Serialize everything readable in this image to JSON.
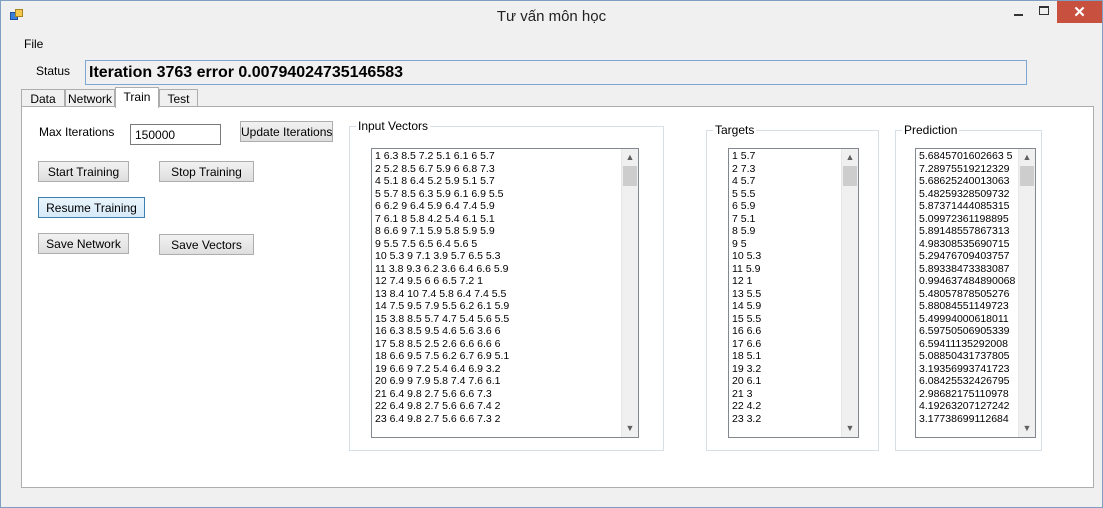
{
  "window": {
    "title": "Tư vấn môn học",
    "close_glyph": "✕",
    "icons": [
      "app-icon",
      "minimize-icon",
      "maximize-icon",
      "close-icon"
    ]
  },
  "menu": {
    "file": "File"
  },
  "status": {
    "label": "Status",
    "text": "Iteration 3763 error 0.00794024735146583"
  },
  "tabs": [
    {
      "label": "Data"
    },
    {
      "label": "Network"
    },
    {
      "label": "Train"
    },
    {
      "label": "Test"
    }
  ],
  "active_tab": "Train",
  "train": {
    "max_iterations_label": "Max Iterations",
    "max_iterations_value": "150000",
    "update_button": "Update Iterations",
    "start_button": "Start Training",
    "stop_button": "Stop Training",
    "resume_button": "Resume Training",
    "save_network_button": "Save Network",
    "save_vectors_button": "Save Vectors"
  },
  "input_vectors": {
    "title": "Input Vectors",
    "items": [
      "1 6.3 8.5 7.2 5.1 6.1 6 5.7",
      "2 5.2 8.5 6.7 5.9 6 6.8 7.3",
      "4 5.1 8 6.4 5.2 5.9 5.1 5.7",
      "5 5.7 8.5 6.3 5.9 6.1 6.9 5.5",
      "6 6.2 9 6.4 5.9 6.4 7.4 5.9",
      "7 6.1 8 5.8 4.2 5.4 6.1 5.1",
      "8 6.6 9 7.1 5.9 5.8 5.9 5.9",
      "9 5.5 7.5 6.5 6.4 5.6 5",
      "10 5.3 9 7.1 3.9 5.7 6.5 5.3",
      "11 3.8 9.3 6.2 3.6 6.4 6.6 5.9",
      "12 7.4 9.5 6 6 6.5 7.2 1",
      "13 8.4 10 7.4 5.8 6.4 7.4 5.5",
      "14 7.5 9.5 7.9 5.5 6.2 6.1 5.9",
      "15 3.8 8.5 5.7 4.7 5.4 5.6 5.5",
      "16 6.3 8.5 9.5 4.6 5.6 3.6 6",
      "17 5.8 8.5 2.5 2.6 6.6 6.6 6",
      "18 6.6 9.5 7.5 6.2 6.7 6.9 5.1",
      "19 6.6 9 7.2 5.4 6.4 6.9 3.2",
      "20 6.9 9 7.9 5.8 7.4 7.6 6.1",
      "21 6.4 9.8 2.7 5.6 6.6 7.3",
      "22 6.4 9.8 2.7 5.6 6.6 7.4 2",
      "23 6.4 9.8 2.7 5.6 6.6 7.3 2"
    ]
  },
  "targets": {
    "title": "Targets",
    "items": [
      "1 5.7",
      "2 7.3",
      "4 5.7",
      "5 5.5",
      "6 5.9",
      "7 5.1",
      "8 5.9",
      "9 5",
      "10 5.3",
      "11 5.9",
      "12 1",
      "13 5.5",
      "14 5.9",
      "15 5.5",
      "16 6.6",
      "17 6.6",
      "18 5.1",
      "19 3.2",
      "20 6.1",
      "21 3",
      "22 4.2",
      "23 3.2"
    ]
  },
  "prediction": {
    "title": "Prediction",
    "items": [
      "5.6845701602663 5",
      "7.28975519212329",
      "5.68625240013063",
      "5.48259328509732",
      "5.87371444085315",
      "5.09972361198895",
      "5.89148557867313",
      "4.98308535690715",
      "5.29476709403757",
      "5.89338473383087",
      "0.994637484890068",
      "5.48057878505276",
      "5.88084551149723",
      "5.49994000618011",
      "6.59750506905339",
      "6.59411135292008",
      "5.08850431737805",
      "3.19356993741723",
      "6.08425532426795",
      "2.98682175110978",
      "4.19263207127242",
      "3.17738699112684"
    ]
  }
}
